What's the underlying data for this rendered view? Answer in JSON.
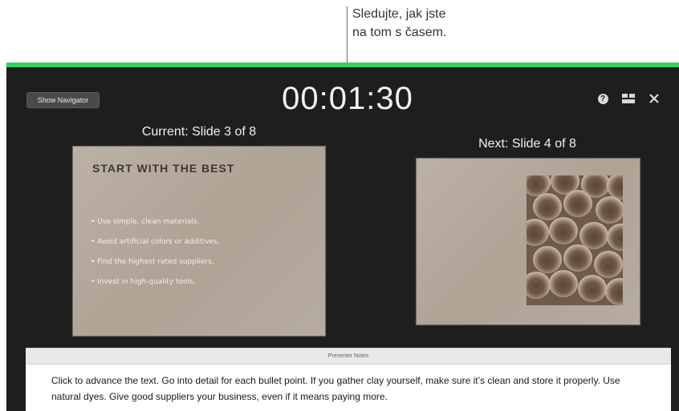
{
  "callout": {
    "line1": "Sledujte, jak jste",
    "line2": "na tom s časem."
  },
  "header": {
    "show_navigator": "Show Navigator",
    "timer": "00:01:30",
    "icons": [
      "help-icon",
      "layout-icon",
      "close-icon"
    ]
  },
  "current": {
    "label": "Current: Slide 3 of 8",
    "title": "START WITH THE BEST",
    "bullets": [
      "Use simple, clean materials.",
      "Avoid artificial colors or additives.",
      "Find the highest rated suppliers.",
      "Invest in high-quality tools."
    ]
  },
  "next": {
    "label": "Next: Slide 4 of 8"
  },
  "notes": {
    "header": "Presenter Notes",
    "text": "Click to advance the text. Go into detail for each bullet point. If you gather clay yourself, make sure it’s clean and store it properly. Use natural dyes. Give good suppliers your business, even if it means paying more."
  },
  "colors": {
    "accent_bar": "#35d15c",
    "background": "#1e1e1e"
  }
}
